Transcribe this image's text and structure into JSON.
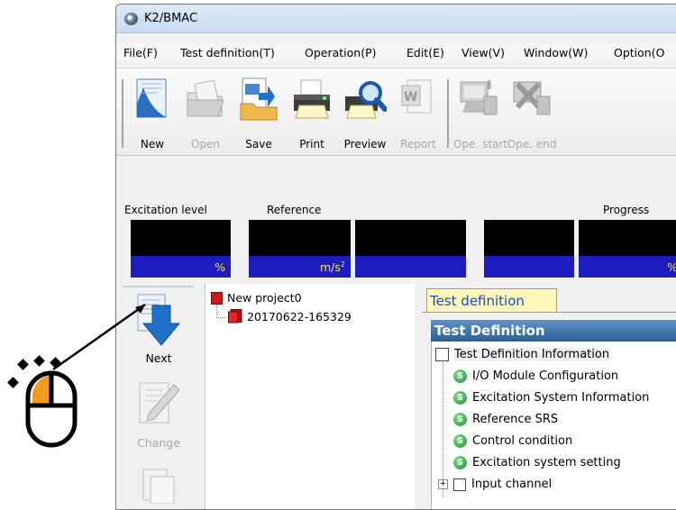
{
  "window": {
    "title": "K2/BMAC"
  },
  "menu": [
    "File(F)",
    "Test definition(T)",
    "Operation(P)",
    "Edit(E)",
    "View(V)",
    "Window(W)",
    "Option(O"
  ],
  "toolbar": [
    {
      "label": "New",
      "enabled": true
    },
    {
      "label": "Open",
      "enabled": false
    },
    {
      "label": "Save",
      "enabled": true
    },
    {
      "label": "Print",
      "enabled": true
    },
    {
      "label": "Preview",
      "enabled": true
    },
    {
      "label": "Report",
      "enabled": false
    },
    {
      "label": "Ope. start",
      "enabled": false
    },
    {
      "label": "Ope. end",
      "enabled": false
    }
  ],
  "meters": {
    "excitation_label": "Excitation level",
    "excitation_unit": "%",
    "reference_label": "Reference",
    "reference_unit_base": "m/s",
    "reference_unit_sup": "2",
    "progress_label": "Progress",
    "progress_unit": "%"
  },
  "left_toolbar": {
    "next_label": "Next",
    "change_label": "Change"
  },
  "project_tree": {
    "project": "New project0",
    "child": "20170622-165329"
  },
  "test_definition": {
    "tab": "Test definition",
    "header": "Test Definition",
    "items": [
      "Test Definition Information",
      "I/O Module Configuration",
      "Excitation System Information",
      "Reference SRS",
      "Control condition",
      "Excitation system setting",
      "Input channel"
    ]
  },
  "colors": {
    "meter_bg": "#000000",
    "meter_unit_bar": "#1c1cbf",
    "meter_unit_text": "#ffe24a",
    "tab_bg": "#fff8b8",
    "header_blue": "#2c5f93"
  },
  "annotation": {
    "icon": "mouse-left-click-icon"
  }
}
